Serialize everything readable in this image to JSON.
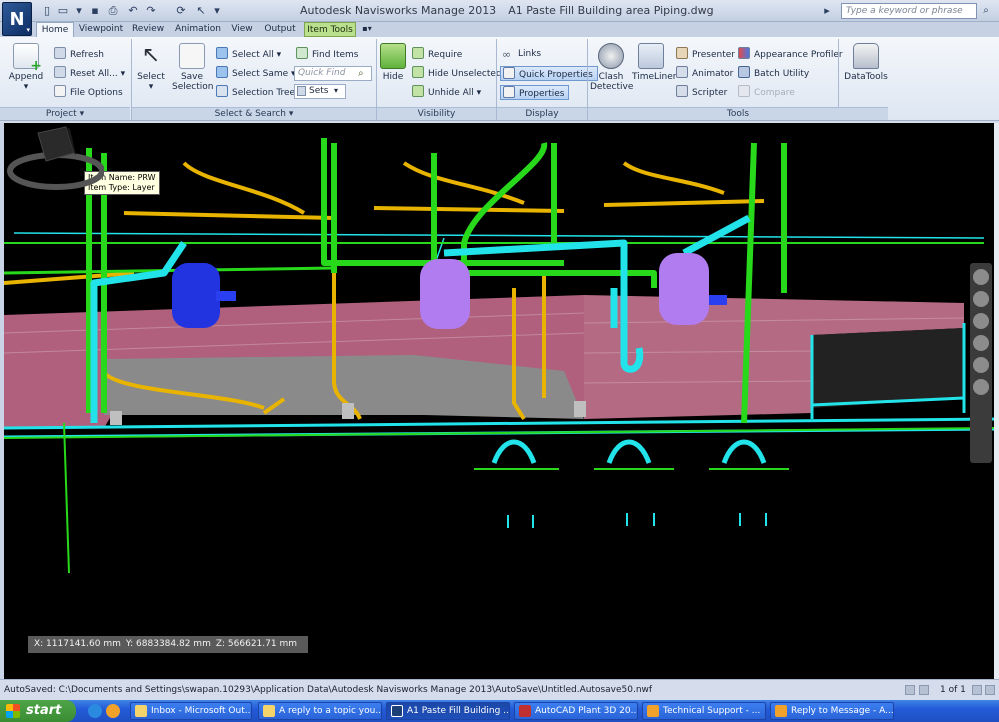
{
  "titlebar": {
    "app_name": "Autodesk Navisworks Manage 2013",
    "document": "A1 Paste Fill Building area Piping.dwg",
    "search_placeholder": "Type a keyword or phrase",
    "app_logo": "N"
  },
  "tabs": [
    {
      "label": "Home",
      "active": true
    },
    {
      "label": "Viewpoint"
    },
    {
      "label": "Review"
    },
    {
      "label": "Animation"
    },
    {
      "label": "View"
    },
    {
      "label": "Output"
    },
    {
      "label": "Item Tools",
      "contextual": true
    }
  ],
  "ribbon": {
    "project": {
      "label": "Project",
      "append": "Append",
      "refresh": "Refresh",
      "reset_all": "Reset All...",
      "file_options": "File Options"
    },
    "select_search": {
      "label": "Select & Search",
      "select": "Select",
      "save_selection_1": "Save",
      "save_selection_2": "Selection",
      "select_all": "Select All",
      "select_same": "Select Same",
      "selection_tree": "Selection Tree",
      "find_items": "Find Items",
      "quick_find_placeholder": "Quick Find",
      "sets": "Sets"
    },
    "visibility": {
      "label": "Visibility",
      "hide": "Hide",
      "require": "Require",
      "hide_unselected": "Hide Unselected",
      "unhide_all": "Unhide All"
    },
    "display": {
      "label": "Display",
      "links": "Links",
      "quick_properties": "Quick Properties",
      "properties": "Properties"
    },
    "tools": {
      "label": "Tools",
      "clash_1": "Clash",
      "clash_2": "Detective",
      "timeliner": "TimeLiner",
      "presenter": "Presenter",
      "animator": "Animator",
      "scripter": "Scripter",
      "appearance_profiler": "Appearance Profiler",
      "batch_utility": "Batch Utility",
      "compare": "Compare",
      "datatools": "DataTools"
    }
  },
  "viewport": {
    "tooltip_line1": "Item Name: PRW",
    "tooltip_line2": "Item Type: Layer",
    "coord_x": "X: 1117141.60 mm",
    "coord_y": "Y: 6883384.82 mm",
    "coord_z": "Z: 566621.71 mm"
  },
  "statusbar": {
    "autosave": "AutoSaved: C:\\Documents and Settings\\swapan.10293\\Application Data\\Autodesk Navisworks Manage 2013\\AutoSave\\Untitled.Autosave50.nwf",
    "page": "1 of 1"
  },
  "taskbar": {
    "start": "start",
    "tasks": [
      "Inbox - Microsoft Out...",
      "A reply to a topic you...",
      "A1 Paste Fill Building ...",
      "AutoCAD Plant 3D 20...",
      "Technical Support - ...",
      "Reply to Message - A..."
    ]
  },
  "colors": {
    "pipe_green": "#27d81b",
    "pipe_yellow": "#e8b400",
    "pipe_cyan": "#22e3ea",
    "floor_pink": "#b0607c",
    "vessel_blue": "#2233e0",
    "vessel_violet": "#b07cf0"
  }
}
